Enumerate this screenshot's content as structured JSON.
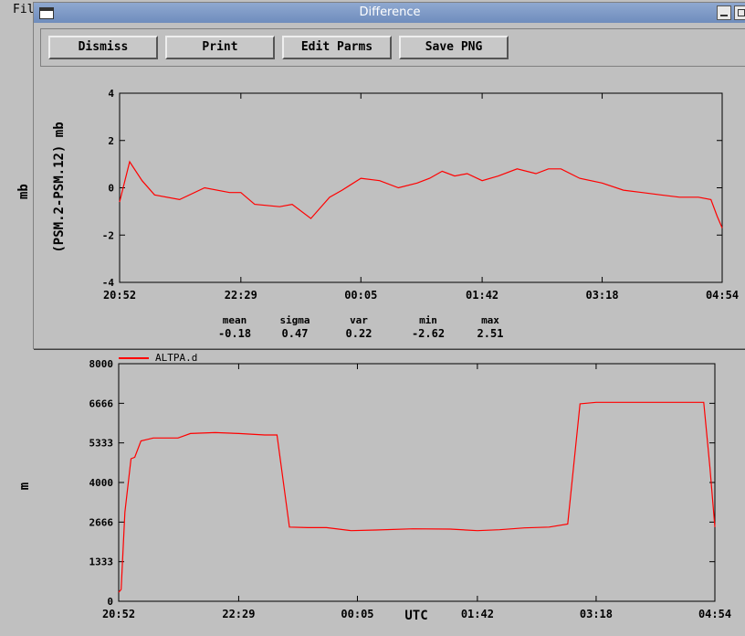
{
  "background_app": {
    "menu_file_label": "Fil",
    "left_plot_ylabel": "mb"
  },
  "dialog": {
    "title": "Difference",
    "buttons": {
      "dismiss": "Dismiss",
      "print": "Print",
      "edit_parms": "Edit Parms",
      "save_png": "Save PNG"
    },
    "stats": {
      "labels": [
        "mean",
        "sigma",
        "var",
        "min",
        "max"
      ],
      "values": [
        "-0.18",
        "0.47",
        "0.22",
        "-2.62",
        "2.51"
      ]
    }
  },
  "chart_data": [
    {
      "type": "line",
      "title": "",
      "xlabel": "",
      "ylabel": "(PSM.2-PSM.12) mb",
      "x_ticks": [
        "20:52",
        "22:29",
        "00:05",
        "01:42",
        "03:18",
        "04:54"
      ],
      "y_ticks": [
        "4",
        "2",
        "0",
        "-2",
        "-4"
      ],
      "ylim": [
        -4,
        4
      ],
      "color": "#ff0000",
      "series": [
        {
          "x": [
            "20:52",
            "21:00",
            "21:10",
            "21:20",
            "21:40",
            "22:00",
            "22:20",
            "22:29",
            "22:40",
            "23:00",
            "23:10",
            "23:25",
            "23:40",
            "23:50",
            "00:05",
            "00:20",
            "00:35",
            "00:50",
            "01:00",
            "01:10",
            "01:20",
            "01:30",
            "01:42",
            "01:55",
            "02:10",
            "02:25",
            "02:35",
            "02:45",
            "03:00",
            "03:18",
            "03:35",
            "03:50",
            "04:05",
            "04:20",
            "04:35",
            "04:45",
            "04:50",
            "04:54"
          ],
          "values": [
            -0.6,
            1.1,
            0.3,
            -0.3,
            -0.5,
            0.0,
            -0.2,
            -0.2,
            -0.7,
            -0.8,
            -0.7,
            -1.3,
            -0.4,
            -0.1,
            0.4,
            0.3,
            0.0,
            0.2,
            0.4,
            0.7,
            0.5,
            0.6,
            0.3,
            0.5,
            0.8,
            0.6,
            0.8,
            0.8,
            0.4,
            0.2,
            -0.1,
            -0.2,
            -0.3,
            -0.4,
            -0.4,
            -0.5,
            -1.2,
            -1.7
          ]
        }
      ]
    },
    {
      "type": "line",
      "title": "",
      "xlabel": "UTC",
      "ylabel": "m",
      "x_ticks": [
        "20:52",
        "22:29",
        "00:05",
        "01:42",
        "03:18",
        "04:54"
      ],
      "y_ticks": [
        "8000",
        "6666",
        "5333",
        "4000",
        "2666",
        "1333",
        "0"
      ],
      "ylim": [
        0,
        8000
      ],
      "color": "#ff0000",
      "legend": "top-left",
      "series": [
        {
          "name": "ALTPA.d",
          "x": [
            "20:52",
            "20:54",
            "20:57",
            "21:02",
            "21:05",
            "21:10",
            "21:15",
            "21:20",
            "21:40",
            "21:50",
            "22:10",
            "22:29",
            "22:50",
            "23:00",
            "23:10",
            "23:25",
            "23:40",
            "00:00",
            "00:20",
            "00:50",
            "01:20",
            "01:42",
            "02:00",
            "02:20",
            "02:40",
            "02:55",
            "03:05",
            "03:18",
            "03:40",
            "04:10",
            "04:30",
            "04:45",
            "04:50",
            "04:54"
          ],
          "values": [
            300,
            400,
            3000,
            4800,
            4850,
            5400,
            5450,
            5500,
            5500,
            5650,
            5680,
            5650,
            5600,
            5600,
            2500,
            2480,
            2480,
            2380,
            2400,
            2440,
            2430,
            2380,
            2410,
            2470,
            2500,
            2600,
            6650,
            6700,
            6700,
            6700,
            6700,
            6700,
            4500,
            2500
          ]
        }
      ]
    }
  ]
}
